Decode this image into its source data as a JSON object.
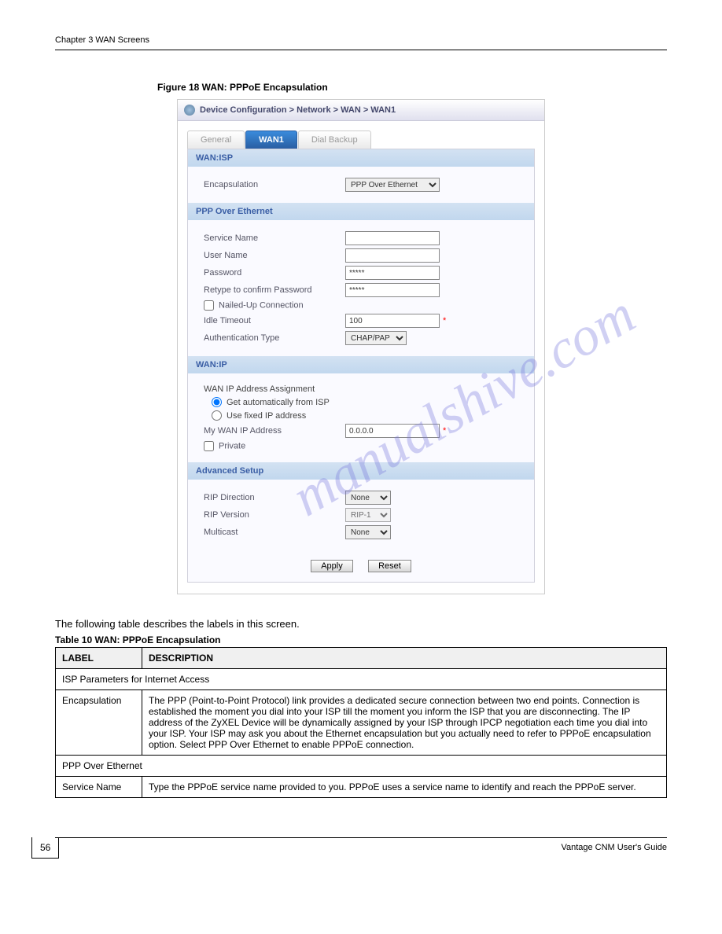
{
  "header": {
    "left": "Chapter 3 WAN Screens"
  },
  "breadcrumb": "Device Configuration > Network > WAN > WAN1",
  "tabs": [
    "General",
    "WAN1",
    "Dial Backup"
  ],
  "sections": {
    "wan_isp": {
      "head": "WAN:ISP",
      "encapsulation_label": "Encapsulation",
      "encapsulation_value": "PPP Over Ethernet"
    },
    "pppoe": {
      "head": "PPP Over Ethernet",
      "service_name_label": "Service Name",
      "user_name_label": "User Name",
      "password_label": "Password",
      "password_value": "*****",
      "retype_label": "Retype to confirm Password",
      "retype_value": "*****",
      "nailed_label": "Nailed-Up Connection",
      "idle_label": "Idle Timeout",
      "idle_value": "100",
      "auth_label": "Authentication Type",
      "auth_value": "CHAP/PAP"
    },
    "wan_ip": {
      "head": "WAN:IP",
      "assign_label": "WAN IP Address Assignment",
      "auto_label": "Get automatically from ISP",
      "fixed_label": "Use fixed IP address",
      "mywan_label": "My WAN IP Address",
      "mywan_value": "0.0.0.0",
      "private_label": "Private"
    },
    "advanced": {
      "head": "Advanced Setup",
      "rip_dir_label": "RIP Direction",
      "rip_dir_value": "None",
      "rip_ver_label": "RIP Version",
      "rip_ver_value": "RIP-1",
      "multicast_label": "Multicast",
      "multicast_value": "None"
    }
  },
  "buttons": {
    "apply": "Apply",
    "reset": "Reset"
  },
  "figure_caption": "Figure 18   WAN: PPPoE Encapsulation",
  "desc_text": "The following table describes the labels in this screen.",
  "table_caption": "Table 10   WAN: PPPoE Encapsulation",
  "table": {
    "head_label": "LABEL",
    "head_desc": "DESCRIPTION",
    "rows": [
      {
        "label": "ISP Parameters for Internet Access",
        "full": true,
        "desc": ""
      },
      {
        "label": "Encapsulation",
        "desc": "The PPP (Point-to-Point Protocol) link provides a dedicated secure connection between two end points. Connection is established the moment you dial into your ISP till the moment you inform the ISP that you are disconnecting. The IP address of the ZyXEL Device will be dynamically assigned by your ISP through IPCP negotiation each time you dial into your ISP. Your ISP may ask you about the Ethernet encapsulation but you actually need to refer to PPPoE encapsulation option. Select PPP Over Ethernet to enable PPPoE connection."
      },
      {
        "label": "PPP Over Ethernet",
        "full": true,
        "desc": ""
      },
      {
        "label": "Service Name",
        "desc": "Type the PPPoE service name provided to you. PPPoE uses a service name to identify and reach the PPPoE server."
      }
    ]
  },
  "footer": {
    "page": "56",
    "text": "Vantage CNM User's Guide"
  },
  "asterisk": "*"
}
